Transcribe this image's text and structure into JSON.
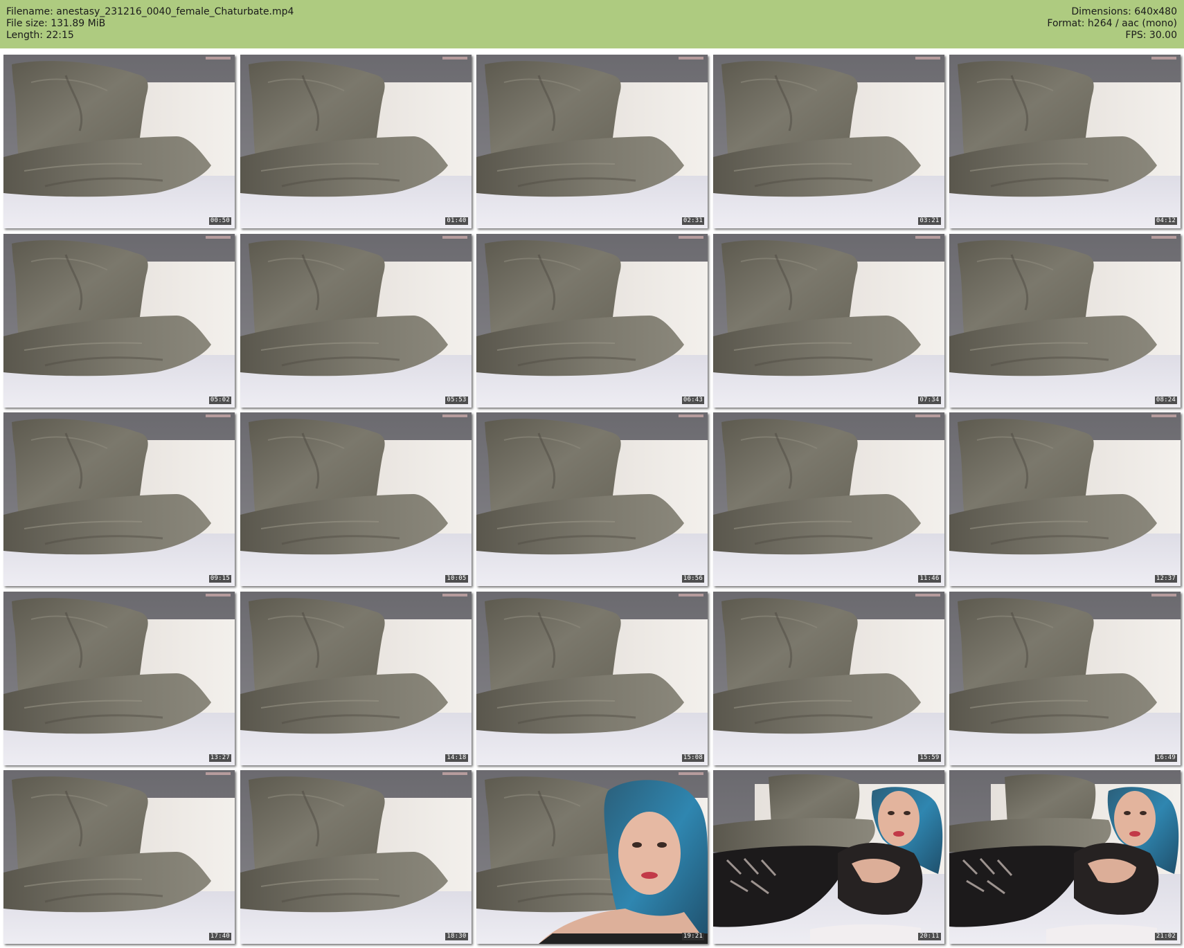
{
  "header": {
    "filename": "Filename: anestasy_231216_0040_female_Chaturbate.mp4",
    "filesize": "File size: 131.89 MiB",
    "length": "Length: 22:15",
    "dimensions": "Dimensions: 640x480",
    "format": "Format: h264 / aac (mono)",
    "fps": "FPS: 30.00",
    "background_color": "#aecb80"
  },
  "thumbnails": [
    {
      "time": "00:50",
      "scene": "pillows"
    },
    {
      "time": "01:40",
      "scene": "pillows"
    },
    {
      "time": "02:31",
      "scene": "pillows"
    },
    {
      "time": "03:21",
      "scene": "pillows"
    },
    {
      "time": "04:12",
      "scene": "pillows"
    },
    {
      "time": "05:02",
      "scene": "pillows"
    },
    {
      "time": "05:53",
      "scene": "pillows"
    },
    {
      "time": "06:43",
      "scene": "pillows"
    },
    {
      "time": "07:34",
      "scene": "pillows"
    },
    {
      "time": "08:24",
      "scene": "pillows"
    },
    {
      "time": "09:15",
      "scene": "pillows"
    },
    {
      "time": "10:05",
      "scene": "pillows"
    },
    {
      "time": "10:56",
      "scene": "pillows"
    },
    {
      "time": "11:46",
      "scene": "pillows"
    },
    {
      "time": "12:37",
      "scene": "pillows"
    },
    {
      "time": "13:27",
      "scene": "pillows"
    },
    {
      "time": "14:18",
      "scene": "pillows"
    },
    {
      "time": "15:08",
      "scene": "pillows"
    },
    {
      "time": "15:59",
      "scene": "pillows"
    },
    {
      "time": "16:49",
      "scene": "pillows"
    },
    {
      "time": "17:40",
      "scene": "pillows"
    },
    {
      "time": "18:30",
      "scene": "pillows"
    },
    {
      "time": "19:21",
      "scene": "person-closeup"
    },
    {
      "time": "20:11",
      "scene": "person-lying"
    },
    {
      "time": "21:02",
      "scene": "person-lying"
    }
  ]
}
